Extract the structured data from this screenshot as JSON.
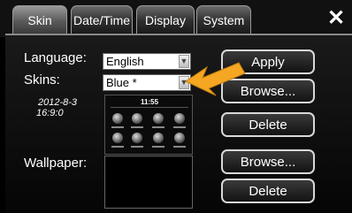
{
  "tabs": [
    {
      "label": "Skin",
      "active": true
    },
    {
      "label": "Date/Time",
      "active": false
    },
    {
      "label": "Display",
      "active": false
    },
    {
      "label": "System",
      "active": false
    }
  ],
  "close_icon": "✕",
  "language": {
    "label": "Language:",
    "value": "English"
  },
  "skins": {
    "label": "Skins:",
    "value": "Blue *",
    "date": "2012-8-3",
    "time": "16:9:0"
  },
  "skin_preview": {
    "clock": "11:55"
  },
  "wallpaper": {
    "label": "Wallpaper:"
  },
  "buttons": {
    "apply": "Apply",
    "browse_skin": "Browse...",
    "delete_skin": "Delete",
    "browse_wallpaper": "Browse...",
    "delete_wallpaper": "Delete"
  },
  "colors": {
    "background": "#000000",
    "highlight_arrow": "#f5a623"
  },
  "icons": [
    "close-icon",
    "select-arrow-icon",
    "pointer-arrow"
  ]
}
